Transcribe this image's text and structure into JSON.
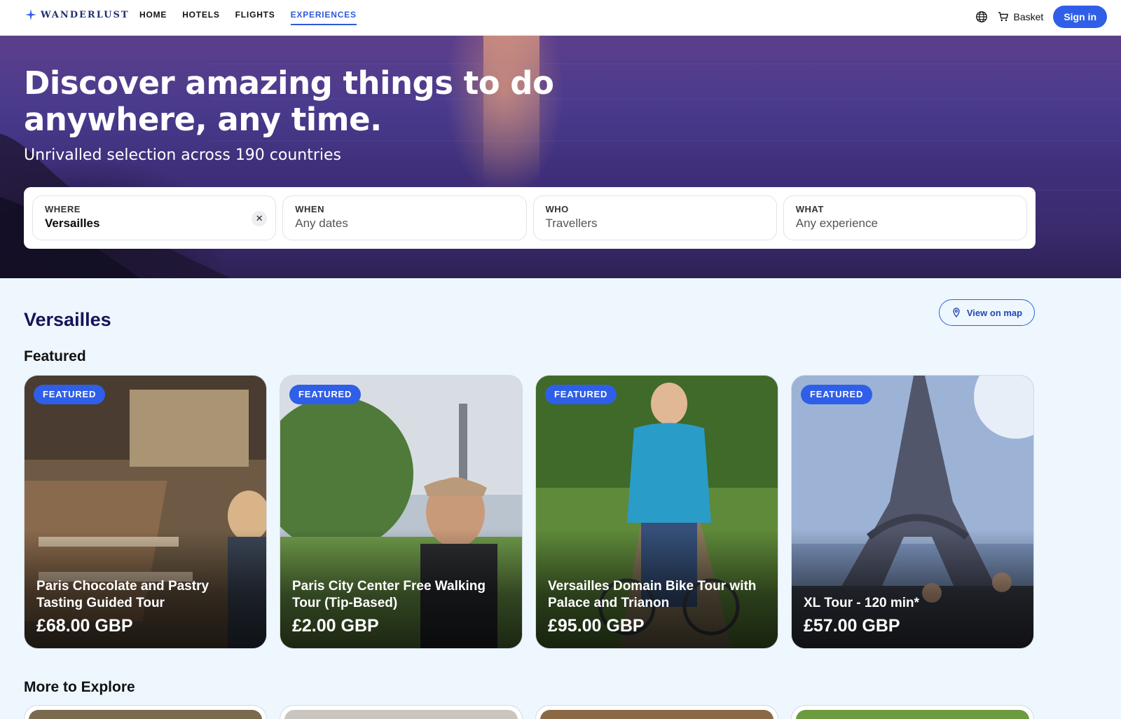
{
  "nav": {
    "logo": "WANDERLUST",
    "links": [
      "HOME",
      "HOTELS",
      "FLIGHTS",
      "EXPERIENCES"
    ],
    "active_link": "EXPERIENCES",
    "basket_label": "Basket",
    "signin_label": "Sign in",
    "icons": {
      "logo": "sparkle-icon",
      "language": "globe-icon",
      "basket": "cart-icon"
    }
  },
  "hero": {
    "title": "Discover amazing things to do anywhere, any time.",
    "subtitle": "Unrivalled selection across 190 countries"
  },
  "search": {
    "where": {
      "label": "WHERE",
      "value": "Versailles"
    },
    "when": {
      "label": "WHEN",
      "placeholder": "Any dates"
    },
    "who": {
      "label": "WHO",
      "placeholder": "Travellers"
    },
    "what": {
      "label": "WHAT",
      "placeholder": "Any experience"
    }
  },
  "main": {
    "location_title": "Versailles",
    "map_button": "View on map",
    "featured_title": "Featured",
    "more_title": "More to Explore"
  },
  "featured": [
    {
      "badge": "FEATURED",
      "name": "Paris Chocolate and Pastry Tasting Guided Tour",
      "price": "£68.00 GBP"
    },
    {
      "badge": "FEATURED",
      "name": "Paris City Center Free Walking Tour (Tip-Based)",
      "price": "£2.00 GBP"
    },
    {
      "badge": "FEATURED",
      "name": "Versailles Domain Bike Tour with Palace and Trianon",
      "price": "£95.00 GBP"
    },
    {
      "badge": "FEATURED",
      "name": "XL Tour - 120 min*",
      "price": "£57.00 GBP"
    }
  ],
  "colors": {
    "accent": "#2f5fe8",
    "heading": "#16135a",
    "background": "#eef7fd"
  }
}
